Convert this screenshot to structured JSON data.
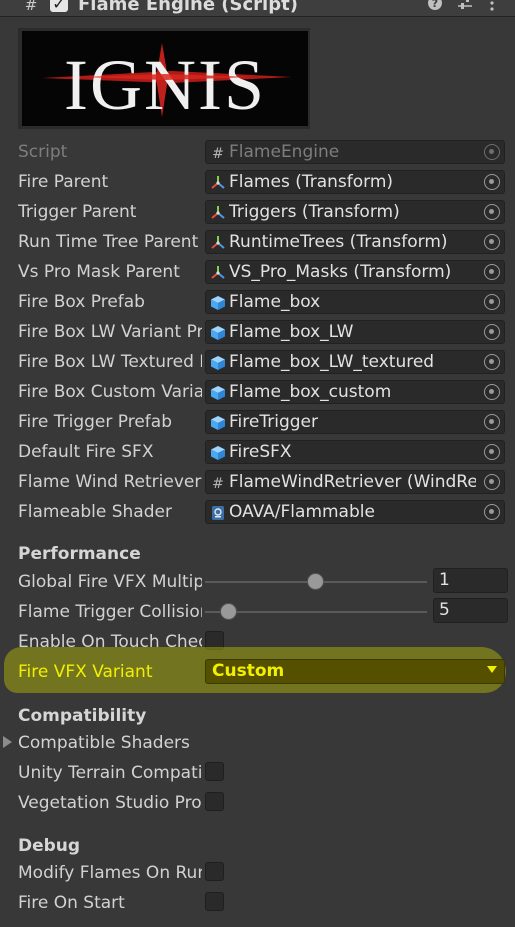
{
  "header": {
    "title": "Flame Engine (Script)",
    "enabled": true,
    "script_icon": "script-hash-icon",
    "help_icon": "help-icon",
    "settings_icon": "preset-sliders-icon",
    "menu_icon": "kebab-menu-icon"
  },
  "logo": {
    "text": "IGNIS",
    "colors": {
      "letters": "#f0f0f0",
      "flare": "#c0201c"
    }
  },
  "fields": [
    {
      "label": "Script",
      "value": "FlameEngine",
      "icon": "script-hash-icon",
      "disabled": true
    },
    {
      "label": "Fire Parent",
      "value": "Flames (Transform)",
      "icon": "transform-icon"
    },
    {
      "label": "Trigger Parent",
      "value": "Triggers (Transform)",
      "icon": "transform-icon"
    },
    {
      "label": "Run Time Tree Parent",
      "value": "RuntimeTrees (Transform)",
      "icon": "transform-icon"
    },
    {
      "label": "Vs Pro Mask Parent",
      "value": "VS_Pro_Masks (Transform)",
      "icon": "transform-icon"
    },
    {
      "label": "Fire Box Prefab",
      "value": "Flame_box",
      "icon": "prefab-cube-icon"
    },
    {
      "label": "Fire Box LW Variant Prefab",
      "value": "Flame_box_LW",
      "icon": "prefab-cube-icon"
    },
    {
      "label": "Fire Box LW Textured Prefab",
      "value": "Flame_box_LW_textured",
      "icon": "prefab-cube-icon"
    },
    {
      "label": "Fire Box Custom Variant Prefab",
      "value": "Flame_box_custom",
      "icon": "prefab-cube-icon"
    },
    {
      "label": "Fire Trigger Prefab",
      "value": "FireTrigger",
      "icon": "prefab-cube-icon"
    },
    {
      "label": "Default Fire SFX",
      "value": "FireSFX",
      "icon": "prefab-cube-icon"
    },
    {
      "label": "Flame Wind Retriever",
      "value": "FlameWindRetriever (WindRetriever)",
      "icon": "script-hash-icon"
    },
    {
      "label": "Flameable Shader",
      "value": "OAVA/Flammable",
      "icon": "shader-icon"
    }
  ],
  "performance": {
    "header": "Performance",
    "sliders": [
      {
        "label": "Global Fire VFX Multiplier",
        "value": "1",
        "fraction": 0.5
      },
      {
        "label": "Flame Trigger Collision",
        "value": "5",
        "fraction": 0.1
      }
    ],
    "toggle_label": "Enable On Touch Check",
    "toggle_value": false,
    "variant_label": "Fire VFX Variant",
    "variant_value": "Custom"
  },
  "compatibility": {
    "header": "Compatibility",
    "foldout_label": "Compatible Shaders",
    "toggles": [
      {
        "label": "Unity Terrain Compatibility",
        "value": false
      },
      {
        "label": "Vegetation Studio Pro",
        "value": false
      }
    ]
  },
  "debug": {
    "header": "Debug",
    "toggles": [
      {
        "label": "Modify Flames On Runtime",
        "value": false
      },
      {
        "label": "Fire On Start",
        "value": false
      }
    ]
  },
  "colors": {
    "background": "#383838",
    "field_bg": "#2a2a2a",
    "highlight": "#c3c800",
    "dropdown_text": "#f2f000"
  }
}
